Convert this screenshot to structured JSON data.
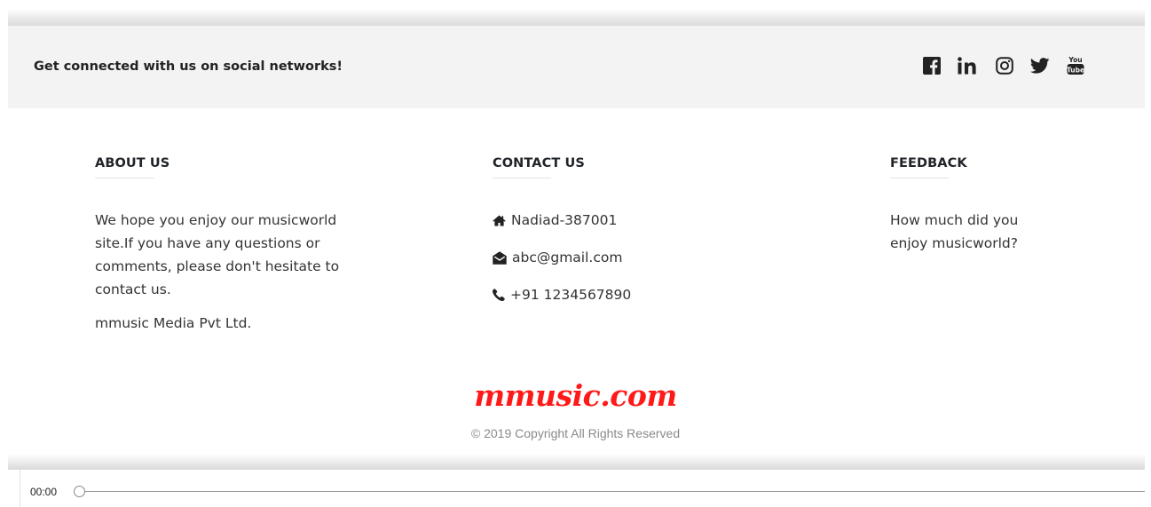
{
  "social": {
    "connect_text": "Get connected with us on social networks!",
    "icons": [
      "facebook-icon",
      "linkedin-icon",
      "instagram-icon",
      "twitter-icon",
      "youtube-icon"
    ],
    "youtube_text_top": "You",
    "youtube_text_bottom": "Tube"
  },
  "about": {
    "title": "ABOUT US",
    "paragraph": "We hope you enjoy our musicworld site.If you have any questions or comments, please don't hesitate to contact us.",
    "company": "mmusic Media Pvt Ltd."
  },
  "contact": {
    "title": "CONTACT US",
    "address": "Nadiad-387001",
    "email": "abc@gmail.com",
    "phone": "+91 1234567890"
  },
  "feedback": {
    "title": "FEEDBACK",
    "question": "How much did you enjoy musicworld?"
  },
  "footer": {
    "brand": "mmusic.com",
    "copyright": "© 2019 Copyright All Rights Reserved",
    "brand_color": "#ff1a1a"
  },
  "player": {
    "time": "00:00",
    "progress": 0
  }
}
